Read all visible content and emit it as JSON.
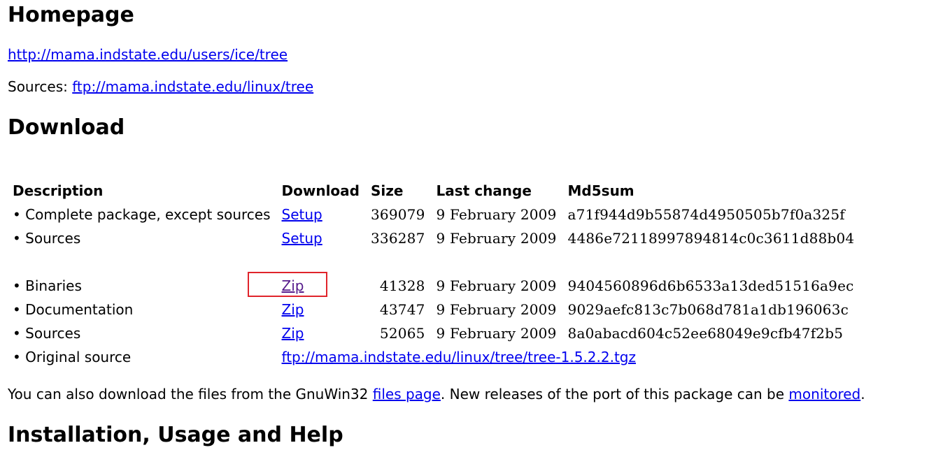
{
  "homepage": {
    "heading": "Homepage",
    "url": "http://mama.indstate.edu/users/ice/tree",
    "sources_prefix": "Sources: ",
    "sources_url": "ftp://mama.indstate.edu/linux/tree"
  },
  "download": {
    "heading": "Download",
    "columns": {
      "description": "Description",
      "download": "Download",
      "size": "Size",
      "last_change": "Last change",
      "md5sum": "Md5sum"
    },
    "rows": [
      {
        "description": "• Complete package, except sources",
        "link": "Setup",
        "size": "369079",
        "last_change": "9 February 2009",
        "md5sum": "a71f944d9b55874d4950505b7f0a325f"
      },
      {
        "description": "• Sources",
        "link": "Setup",
        "size": "336287",
        "last_change": "9 February 2009",
        "md5sum": "4486e72118997894814c0c3611d88b04"
      },
      {
        "description": "• Binaries",
        "link": "Zip",
        "size": "41328",
        "last_change": "9 February 2009",
        "md5sum": "9404560896d6b6533a13ded51516a9ec"
      },
      {
        "description": "• Documentation",
        "link": "Zip",
        "size": "43747",
        "last_change": "9 February 2009",
        "md5sum": "9029aefc813c7b068d781a1db196063c"
      },
      {
        "description": "• Sources",
        "link": "Zip",
        "size": "52065",
        "last_change": "9 February 2009",
        "md5sum": "8a0abacd604c52ee68049e9cfb47f2b5"
      },
      {
        "description": "• Original source",
        "link": "ftp://mama.indstate.edu/linux/tree/tree-1.5.2.2.tgz"
      }
    ],
    "also_text_1": "You can also download the files from the GnuWin32 ",
    "also_link_1": "files page",
    "also_text_2": ". New releases of the port of this package can be ",
    "also_link_2": "monitored",
    "also_text_3": "."
  },
  "installation": {
    "heading": "Installation, Usage and Help"
  },
  "colors": {
    "link": "#0000ee",
    "visited_link": "#551a8b",
    "highlight_box": "#e0242b"
  }
}
